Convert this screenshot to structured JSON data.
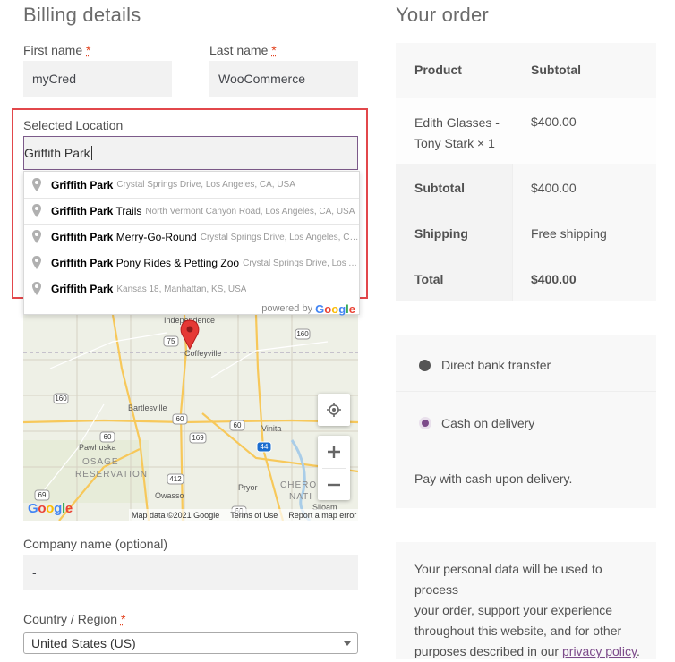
{
  "billing": {
    "title": "Billing details",
    "first_name_label": "First name",
    "first_name_value": "myCred",
    "last_name_label": "Last name",
    "last_name_value": "WooCommerce",
    "required_mark": "*",
    "location_label": "Selected Location",
    "location_value": "Griffith Park",
    "suggestions": [
      {
        "main": "Griffith Park",
        "extra": "",
        "secondary": "Crystal Springs Drive, Los Angeles, CA, USA"
      },
      {
        "main": "Griffith Park",
        "extra": " Trails",
        "secondary": "North Vermont Canyon Road, Los Angeles, CA, USA"
      },
      {
        "main": "Griffith Park",
        "extra": " Merry-Go-Round",
        "secondary": "Crystal Springs Drive, Los Angeles, CA, ..."
      },
      {
        "main": "Griffith Park",
        "extra": " Pony Rides & Petting Zoo",
        "secondary": "Crystal Springs Drive, Los An..."
      },
      {
        "main": "Griffith Park",
        "extra": "",
        "secondary": "Kansas 18, Manhattan, KS, USA"
      }
    ],
    "powered_by": "powered by",
    "google_logo": "Google",
    "map": {
      "places": [
        "Independence",
        "Coffeyville",
        "Bartlesville",
        "Pawhuska",
        "OSAGE",
        "RESERVATION",
        "Vinita",
        "Owasso",
        "Pryor",
        "CHERO",
        "NATI",
        "Siloam"
      ],
      "roads": [
        "75",
        "160",
        "160",
        "60",
        "60",
        "60",
        "169",
        "44",
        "69",
        "412",
        "60"
      ],
      "map_data": "Map data ©2021 Google",
      "terms": "Terms of Use",
      "report": "Report a map error",
      "logo": "Google"
    },
    "company_label": "Company name (optional)",
    "company_value": "-",
    "country_label": "Country / Region",
    "country_value": "United States (US)"
  },
  "order": {
    "title": "Your order",
    "col_product": "Product",
    "col_subtotal": "Subtotal",
    "item_name_line1": "Edith Glasses -",
    "item_name_line2": "Tony Stark",
    "item_qty": "× 1",
    "item_price": "$400.00",
    "subtotal_label": "Subtotal",
    "subtotal_value": "$400.00",
    "shipping_label": "Shipping",
    "shipping_value": "Free shipping",
    "total_label": "Total",
    "total_value": "$400.00"
  },
  "payment": {
    "option1": "Direct bank transfer",
    "option2": "Cash on delivery",
    "description": "Pay with cash upon delivery.",
    "privacy_line1": "Your personal data will be used to process",
    "privacy_line2": "your order, support your experience",
    "privacy_line3": "throughout this website, and for other",
    "privacy_line4_prefix": "purposes described in our",
    "privacy_link": "privacy policy",
    "privacy_suffix": "."
  },
  "colors": {
    "accent": "#7c4a8a",
    "highlight": "#e2474b",
    "required": "#e2401c"
  }
}
